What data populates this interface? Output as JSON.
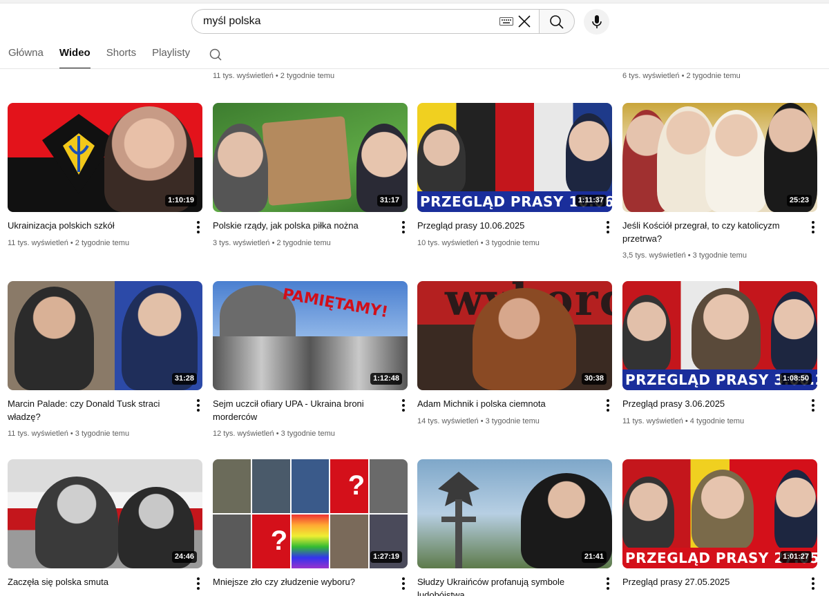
{
  "search": {
    "query": "myśl polska",
    "keyboard_icon": "keyboard-icon",
    "clear_icon": "close-icon",
    "search_icon": "search-icon",
    "mic_icon": "microphone-icon"
  },
  "tabs": [
    {
      "label": "Główna",
      "active": false
    },
    {
      "label": "Wideo",
      "active": true
    },
    {
      "label": "Shorts",
      "active": false
    },
    {
      "label": "Playlisty",
      "active": false
    }
  ],
  "partial_row": [
    {
      "meta": "11 tys. wyświetleń • 2 tygodnie temu"
    },
    {
      "meta": "6 tys. wyświetleń • 2 tygodnie temu"
    }
  ],
  "videos": [
    {
      "title": "Ukrainizacja polskich szkół",
      "meta": "11 tys. wyświetleń • 2 tygodnie temu",
      "duration": "1:10:19"
    },
    {
      "title": "Polskie rządy, jak polska piłka nożna",
      "meta": "3 tys. wyświetleń • 2 tygodnie temu",
      "duration": "31:17"
    },
    {
      "title": "Przegląd prasy 10.06.2025",
      "meta": "10 tys. wyświetleń • 3 tygodnie temu",
      "duration": "1:11:37",
      "banner": "PRZEGLĄD PRASY 10.06.2025"
    },
    {
      "title": "Jeśli Kościół przegrał, to czy katolicyzm przetrwa?",
      "meta": "3,5 tys. wyświetleń • 3 tygodnie temu",
      "duration": "25:23"
    },
    {
      "title": "Marcin Palade: czy Donald Tusk straci władzę?",
      "meta": "11 tys. wyświetleń • 3 tygodnie temu",
      "duration": "31:28"
    },
    {
      "title": "Sejm uczcił ofiary UPA - Ukraina broni morderców",
      "meta": "12 tys. wyświetleń • 3 tygodnie temu",
      "duration": "1:12:48",
      "overlay": "PAMIĘTAMY!"
    },
    {
      "title": "Adam Michnik i polska ciemnota",
      "meta": "14 tys. wyświetleń • 3 tygodnie temu",
      "duration": "30:38",
      "overlay": "wyborc"
    },
    {
      "title": "Przegląd prasy 3.06.2025",
      "meta": "11 tys. wyświetleń • 4 tygodnie temu",
      "duration": "1:08:50",
      "banner": "PRZEGLĄD PRASY 3.06.2025"
    },
    {
      "title": "Zaczęła się polska smuta",
      "meta": "",
      "duration": "24:46"
    },
    {
      "title": "Mniejsze zło czy złudzenie wyboru?",
      "meta": "",
      "duration": "1:27:19",
      "overlay": "?"
    },
    {
      "title": "Słudzy Ukraińców profanują symbole ludobójstwa",
      "meta": "",
      "duration": "21:41"
    },
    {
      "title": "Przegląd prasy 27.05.2025",
      "meta": "",
      "duration": "1:01:27",
      "banner": "PRZEGLĄD PRASY 27.05.2025"
    }
  ],
  "colors": {
    "accent": "#0f0f0f",
    "muted": "#606060",
    "banner_blue": "#1a2e9b",
    "banner_red": "#d4101a"
  }
}
